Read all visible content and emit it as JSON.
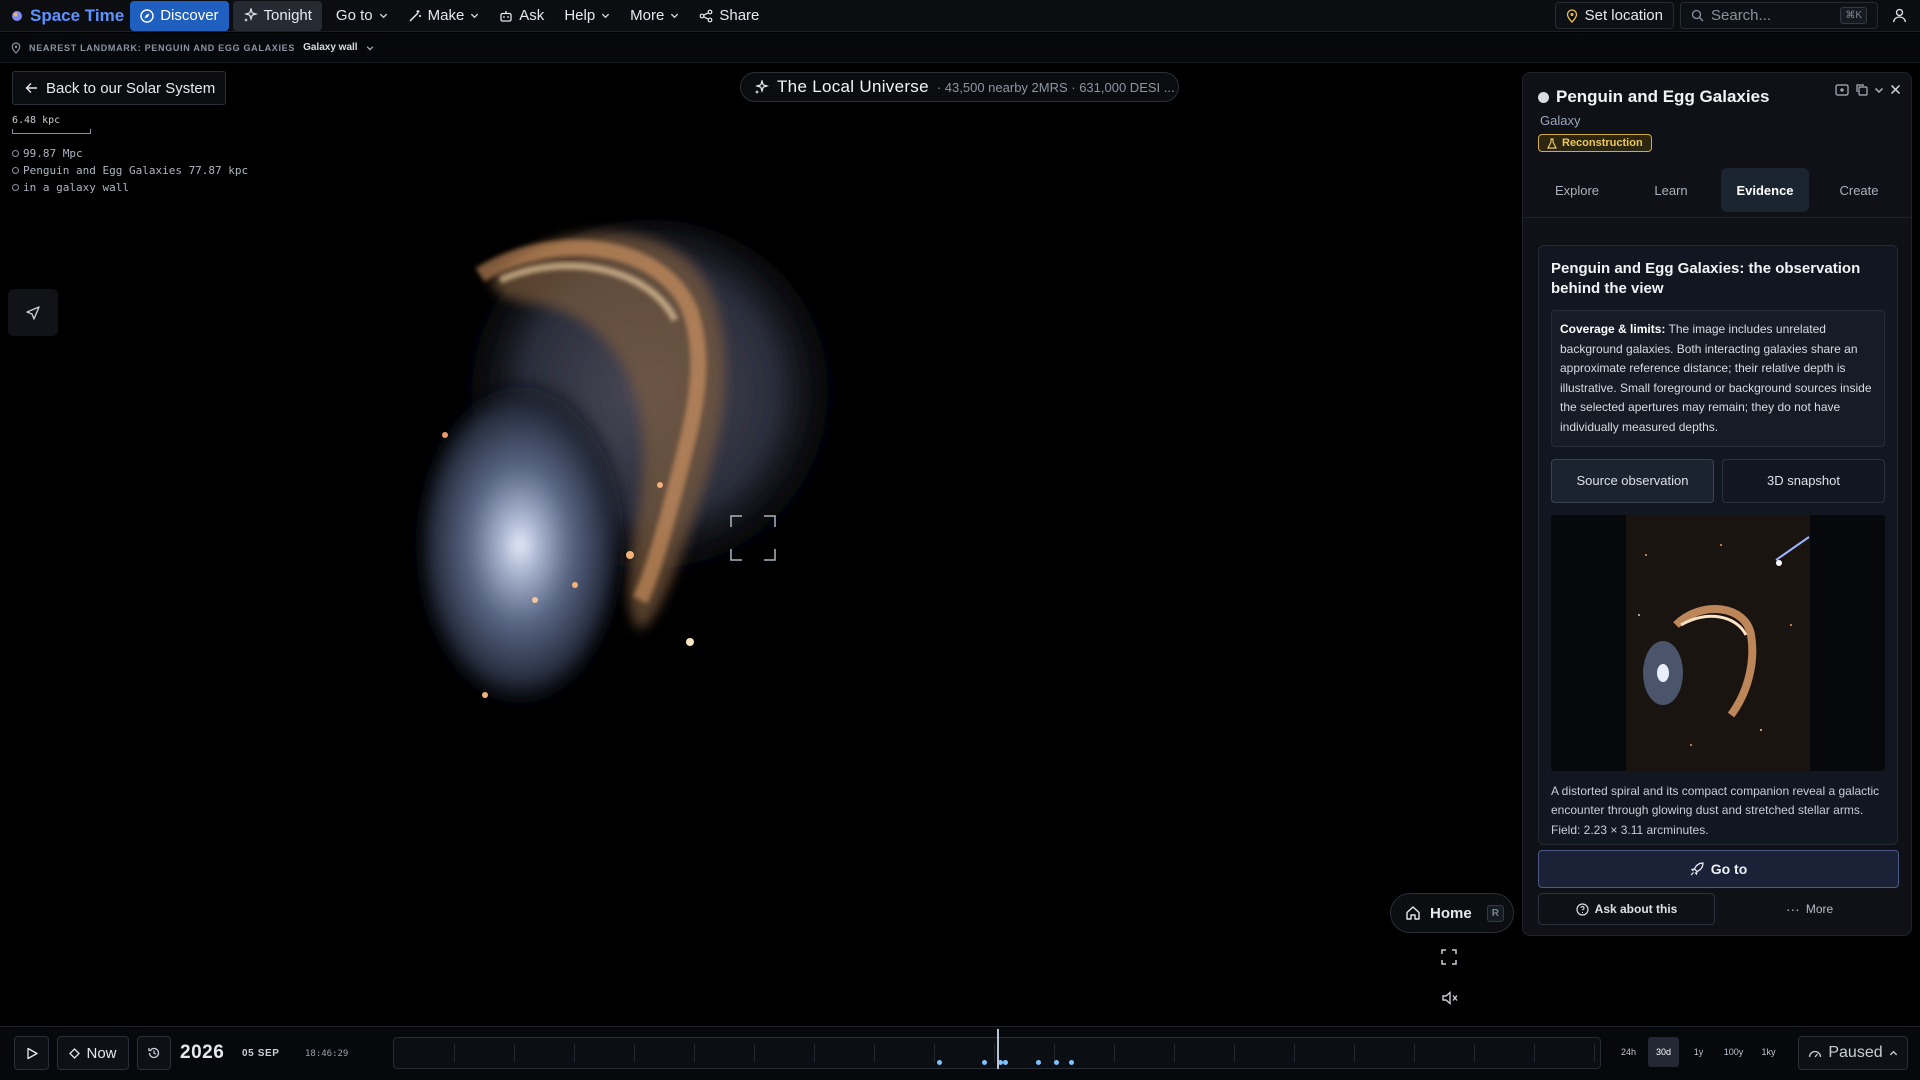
{
  "topbar": {
    "brand": "Space Time",
    "nav": [
      {
        "label": "Discover",
        "icon": "compass-icon"
      },
      {
        "label": "Tonight",
        "icon": "sparkles-icon"
      },
      {
        "label": "Go to",
        "icon": "chevron-down-icon"
      },
      {
        "label": "Make",
        "icon": "wand-icon"
      },
      {
        "label": "Ask",
        "icon": "robot-icon"
      },
      {
        "label": "Help",
        "icon": "chevron-down-icon"
      },
      {
        "label": "More",
        "icon": "chevron-down-icon"
      },
      {
        "label": "Share",
        "icon": "share-icon"
      }
    ],
    "set_location": "Set location",
    "search_placeholder": "Search...",
    "search_shortcut": "⌘K",
    "accent": "#1f5fbf"
  },
  "landmark": {
    "label": "NEAREST LANDMARK: PENGUIN AND EGG GALAXIES",
    "wall": "Galaxy wall"
  },
  "back_button": "Back to our Solar System",
  "scale": "6.48 kpc",
  "coords": [
    "99.87 Mpc",
    "Penguin and Egg Galaxies 77.87 kpc",
    "in a galaxy wall"
  ],
  "view_title": {
    "name": "The Local Universe",
    "meta": "· 43,500 nearby 2MRS · 631,000 DESI ..."
  },
  "home_button": {
    "label": "Home",
    "shortcut": "R"
  },
  "panel": {
    "title": "Penguin and Egg Galaxies",
    "type": "Galaxy",
    "badge": "Reconstruction",
    "badge_color": "#ebc75c",
    "tabs": [
      "Explore",
      "Learn",
      "Evidence",
      "Create"
    ],
    "active_tab": "Evidence",
    "card_title": "Penguin and Egg Galaxies: the observation behind the view",
    "coverage_label": "Coverage & limits:",
    "coverage_text": "The image includes unrelated background galaxies. Both interacting galaxies share an approximate reference distance; their relative depth is illustrative. Small foreground or background sources inside the selected apertures may remain; they do not have individually measured depths.",
    "evidence_tabs": [
      "Source observation",
      "3D snapshot"
    ],
    "caption": "A distorted spiral and its compact companion reveal a galactic encounter through glowing dust and stretched stellar arms. Field: 2.23 × 3.11 arcminutes.",
    "goto": "Go to",
    "ask": "Ask about this",
    "more": "More"
  },
  "timebar": {
    "now": "Now",
    "year": "2026",
    "date": "05 SEP",
    "time": "18:46:29",
    "ranges": [
      "24h",
      "30d",
      "1y",
      "100y",
      "1ky"
    ],
    "active_range": "30d",
    "status": "Paused"
  }
}
